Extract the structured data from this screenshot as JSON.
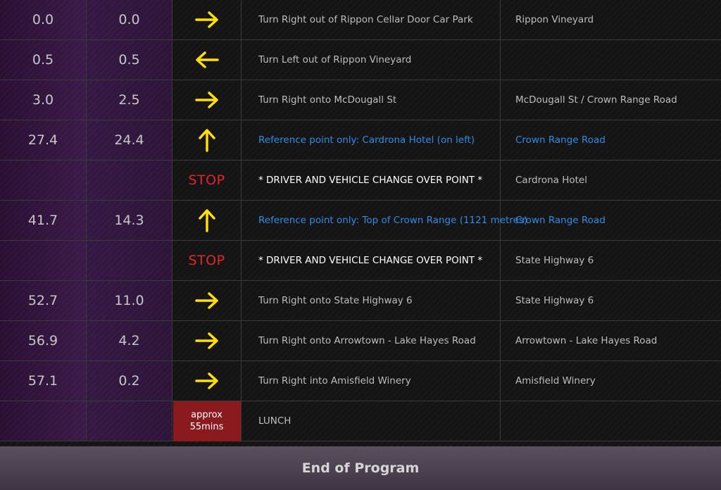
{
  "colors": {
    "arrow": "#ffe000",
    "stop": "#e0262a",
    "reference": "#2f8be6",
    "approx_bg": "#8b1a1f"
  },
  "rows": [
    {
      "cum": "0.0",
      "leg": "0.0",
      "direction": "right-arrow-icon",
      "instruction": "Turn Right out of Rippon Cellar Door Car Park",
      "road": "Rippon Vineyard",
      "style": "normal"
    },
    {
      "cum": "0.5",
      "leg": "0.5",
      "direction": "left-arrow-icon",
      "instruction": "Turn Left out of Rippon Vineyard",
      "road": "",
      "style": "normal"
    },
    {
      "cum": "3.0",
      "leg": "2.5",
      "direction": "right-arrow-icon",
      "instruction": "Turn Right onto McDougall St",
      "road": "McDougall St / Crown Range Road",
      "style": "normal"
    },
    {
      "cum": "27.4",
      "leg": "24.4",
      "direction": "up-arrow-icon",
      "instruction": "Reference point only: Cardrona Hotel (on left)",
      "road": "Crown Range Road",
      "style": "ref"
    },
    {
      "cum": "",
      "leg": "",
      "direction": "stop",
      "stop_label": "STOP",
      "instruction": "* DRIVER AND VEHICLE CHANGE OVER POINT *",
      "road": "Cardrona Hotel",
      "style": "driver"
    },
    {
      "cum": "41.7",
      "leg": "14.3",
      "direction": "up-arrow-icon",
      "instruction": "Reference point only: Top of Crown Range (1121 metres)",
      "road": "Crown Range Road",
      "style": "ref"
    },
    {
      "cum": "",
      "leg": "",
      "direction": "stop",
      "stop_label": "STOP",
      "instruction": "* DRIVER AND VEHICLE CHANGE OVER POINT *",
      "road": "State Highway 6",
      "style": "driver"
    },
    {
      "cum": "52.7",
      "leg": "11.0",
      "direction": "right-arrow-icon",
      "instruction": "Turn Right onto State Highway 6",
      "road": "State Highway 6",
      "style": "normal"
    },
    {
      "cum": "56.9",
      "leg": "4.2",
      "direction": "right-arrow-icon",
      "instruction": "Turn Right onto Arrowtown - Lake Hayes Road",
      "road": "Arrowtown - Lake Hayes Road",
      "style": "normal"
    },
    {
      "cum": "57.1",
      "leg": "0.2",
      "direction": "right-arrow-icon",
      "instruction": "Turn Right into Amisfield Winery",
      "road": "Amisfield Winery",
      "style": "normal"
    },
    {
      "cum": "",
      "leg": "",
      "direction": "approx",
      "approx_line1": "approx",
      "approx_line2": "55mins",
      "instruction": "LUNCH",
      "road": "",
      "style": "normal"
    }
  ],
  "footer": {
    "label": "End of Program"
  }
}
